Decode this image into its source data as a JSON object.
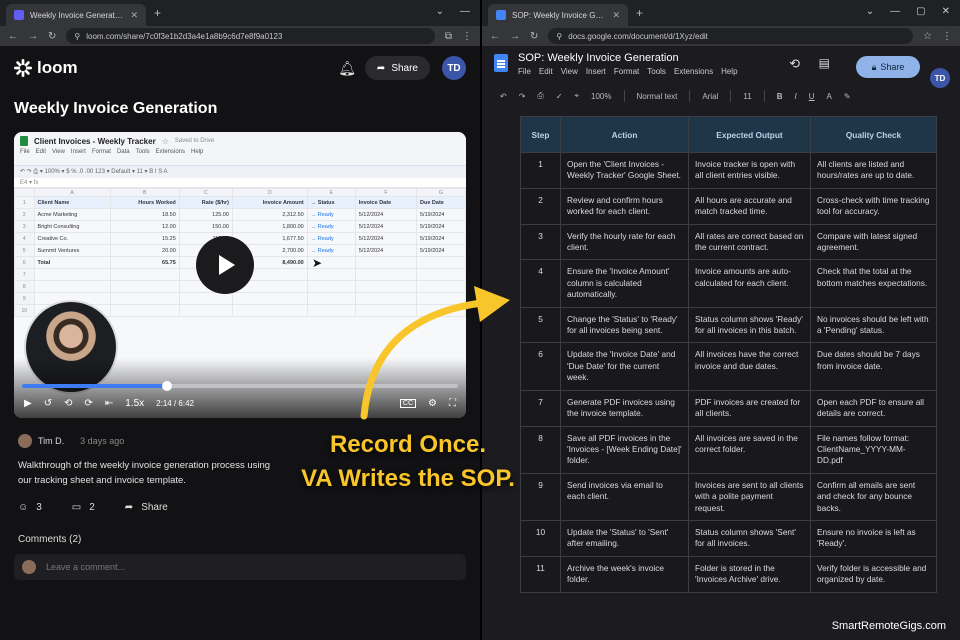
{
  "left_window": {
    "tab_title": "Weekly Invoice Generation - Loom",
    "url": "loom.com/share/7c0f3e1b2d3a4e1a8b9c6d7e8f9a0123",
    "brand": "loom",
    "share_label": "Share",
    "avatar_initials": "TD",
    "video_title": "Weekly Invoice Generation",
    "sheet": {
      "title": "Client Invoices - Weekly Tracker",
      "saved": "Saved to Drive",
      "menu": [
        "File",
        "Edit",
        "View",
        "Insert",
        "Format",
        "Data",
        "Tools",
        "Extensions",
        "Help"
      ],
      "columns": [
        "A",
        "B",
        "C",
        "D",
        "E",
        "F",
        "G"
      ],
      "header": [
        "Client Name",
        "Hours Worked",
        "Rate ($/hr)",
        "Invoice Amount",
        "Status",
        "Invoice Date",
        "Due Date"
      ],
      "rows": [
        [
          "Acme Marketing",
          "18.50",
          "125.00",
          "2,312.50",
          "Ready",
          "5/12/2024",
          "5/19/2024"
        ],
        [
          "Bright Consulting",
          "12.00",
          "150.00",
          "1,800.00",
          "Ready",
          "5/12/2024",
          "5/19/2024"
        ],
        [
          "Creative Co.",
          "15.25",
          "110.00",
          "1,677.50",
          "Ready",
          "5/12/2024",
          "5/19/2024"
        ],
        [
          "Summit Ventures",
          "20.00",
          "135.00",
          "2,700.00",
          "Ready",
          "5/12/2024",
          "5/19/2024"
        ]
      ],
      "total": [
        "Total",
        "65.75",
        "",
        "8,490.00",
        "",
        "",
        ""
      ],
      "row_numbers": [
        "1",
        "2",
        "3",
        "4",
        "5",
        "6",
        "7",
        "8",
        "9",
        "10"
      ]
    },
    "player": {
      "speed": "1.5x",
      "time": "2:14 / 6:42",
      "progress": 0.333,
      "cc": "CC"
    },
    "author": "Tim D.",
    "posted": "3 days ago",
    "description": "Walkthrough of the weekly invoice generation process using our tracking sheet and invoice template.",
    "reactions": "3",
    "comment_count": "2",
    "share_text": "Share",
    "comments_heading": "Comments (2)",
    "comment_placeholder": "Leave a comment..."
  },
  "right_window": {
    "tab_title": "SOP: Weekly Invoice Generation - Google Docs",
    "url": "docs.google.com/document/d/1Xyz/edit",
    "doc_title": "SOP: Weekly Invoice Generation",
    "menu": [
      "File",
      "Edit",
      "View",
      "Insert",
      "Format",
      "Tools",
      "Extensions",
      "Help"
    ],
    "share_label": "Share",
    "avatar_initials": "TD",
    "zoom": "100%",
    "style": "Normal text",
    "font": "Arial",
    "font_size": "11",
    "table_headers": [
      "Step",
      "Action",
      "Expected Output",
      "Quality Check"
    ],
    "steps": [
      {
        "step": "1",
        "action": "Open the 'Client Invoices - Weekly Tracker' Google Sheet.",
        "output": "Invoice tracker is open with all client entries visible.",
        "check": "All clients are listed and hours/rates are up to date."
      },
      {
        "step": "2",
        "action": "Review and confirm hours worked for each client.",
        "output": "All hours are accurate and match tracked time.",
        "check": "Cross-check with time tracking tool for accuracy."
      },
      {
        "step": "3",
        "action": "Verify the hourly rate for each client.",
        "output": "All rates are correct based on the current contract.",
        "check": "Compare with latest signed agreement."
      },
      {
        "step": "4",
        "action": "Ensure the 'Invoice Amount' column is calculated automatically.",
        "output": "Invoice amounts are auto-calculated for each client.",
        "check": "Check that the total at the bottom matches expectations."
      },
      {
        "step": "5",
        "action": "Change the 'Status' to 'Ready' for all invoices being sent.",
        "output": "Status column shows 'Ready' for all invoices in this batch.",
        "check": "No invoices should be left with a 'Pending' status."
      },
      {
        "step": "6",
        "action": "Update the 'Invoice Date' and 'Due Date' for the current week.",
        "output": "All invoices have the correct invoice and due dates.",
        "check": "Due dates should be 7 days from invoice date."
      },
      {
        "step": "7",
        "action": "Generate PDF invoices using the invoice template.",
        "output": "PDF invoices are created for all clients.",
        "check": "Open each PDF to ensure all details are correct."
      },
      {
        "step": "8",
        "action": "Save all PDF invoices in the 'Invoices - [Week Ending Date]' folder.",
        "output": "All invoices are saved in the correct folder.",
        "check": "File names follow format: ClientName_YYYY-MM-DD.pdf"
      },
      {
        "step": "9",
        "action": "Send invoices via email to each client.",
        "output": "Invoices are sent to all clients with a polite payment request.",
        "check": "Confirm all emails are sent and check for any bounce backs."
      },
      {
        "step": "10",
        "action": "Update the 'Status' to 'Sent' after emailing.",
        "output": "Status column shows 'Sent' for all invoices.",
        "check": "Ensure no invoice is left as 'Ready'."
      },
      {
        "step": "11",
        "action": "Archive the week's invoice folder.",
        "output": "Folder is stored in the 'Invoices Archive' drive.",
        "check": "Verify folder is accessible and organized by date."
      }
    ]
  },
  "overlay": {
    "line1": "Record Once.",
    "line2": "VA Writes the SOP.",
    "color": "#f8c52a"
  },
  "watermark": "SmartRemoteGigs.com"
}
